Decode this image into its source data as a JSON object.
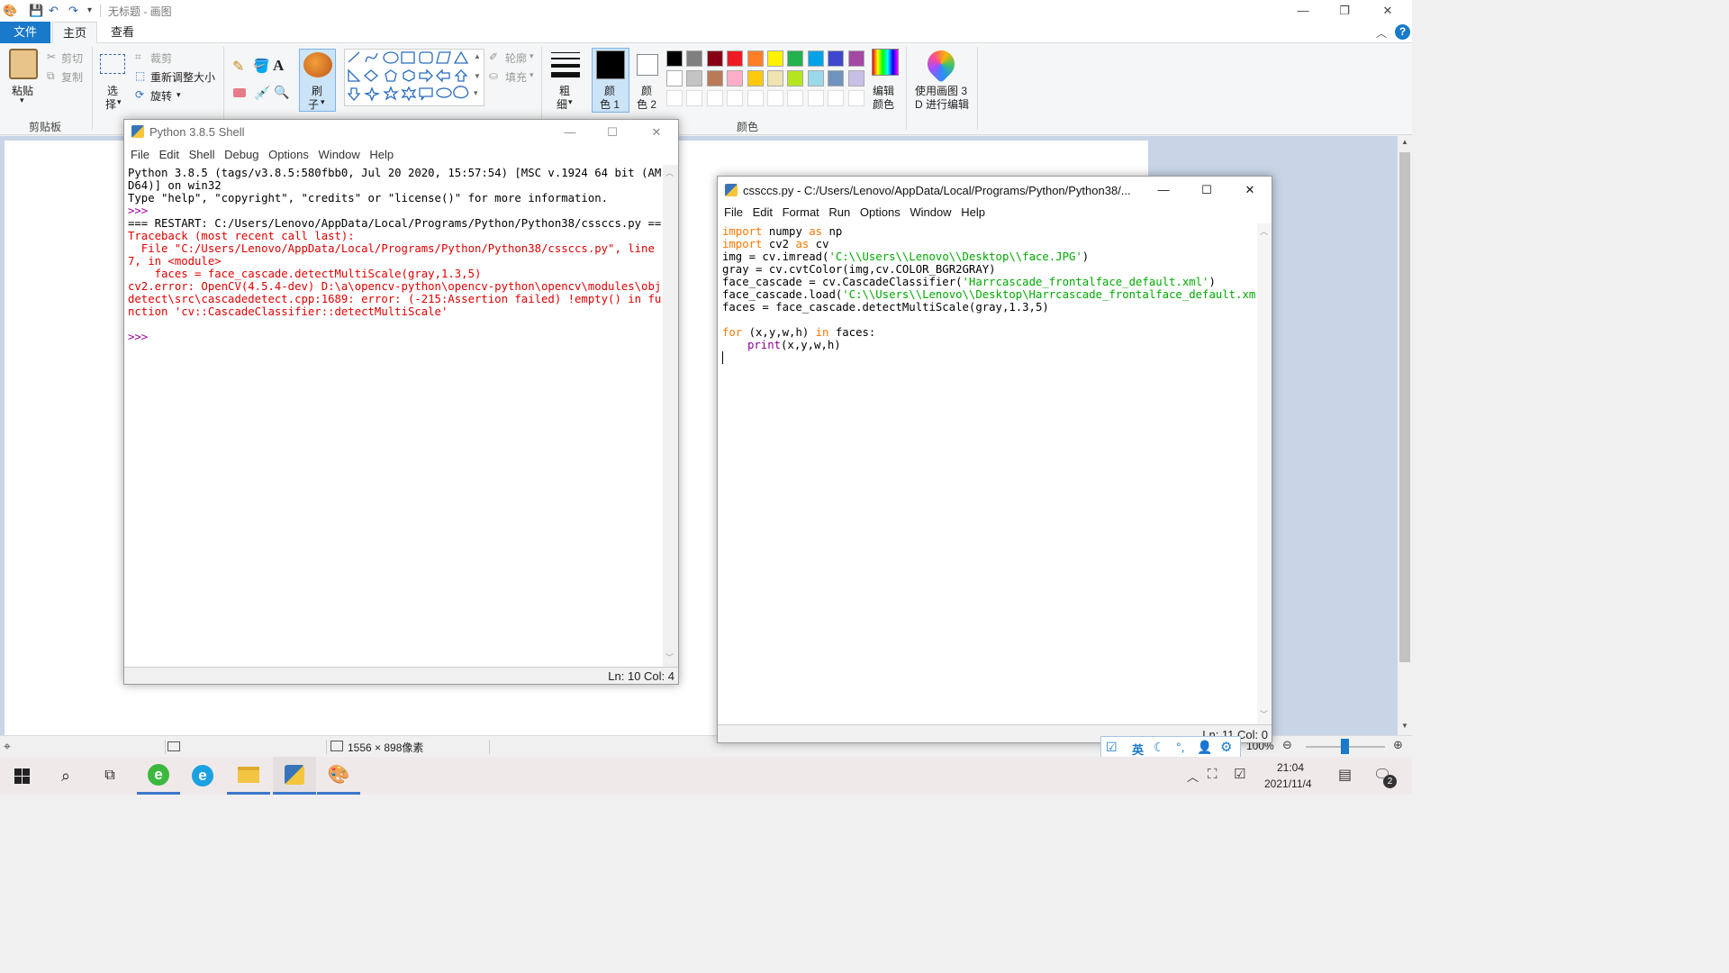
{
  "paint": {
    "title": "无标题 - 画图",
    "tabs": {
      "file": "文件",
      "home": "主页",
      "view": "查看"
    },
    "clipboard": {
      "paste": "粘贴",
      "cut": "剪切",
      "copy": "复制",
      "group": "剪贴板"
    },
    "image": {
      "select1": "选",
      "select2": "择",
      "crop": "裁剪",
      "resize": "重新调整大小",
      "rotate": "旋转"
    },
    "tools": {
      "brush1": "刷",
      "brush2": "子"
    },
    "shapes": {
      "outline": "轮廓",
      "fill": "填充"
    },
    "size": {
      "l1": "粗",
      "l2": "细"
    },
    "color1": {
      "l1": "颜",
      "l2": "色 1"
    },
    "color2": {
      "l1": "颜",
      "l2": "色 2"
    },
    "edit_colors": {
      "l1": "编辑",
      "l2": "颜色"
    },
    "paint3d": {
      "l1": "使用画图 3",
      "l2": "D 进行编辑"
    },
    "colors_group": "颜色",
    "palette_row1": [
      "#000000",
      "#7f7f7f",
      "#880015",
      "#ed1c24",
      "#ff7f27",
      "#fff200",
      "#22b14c",
      "#00a2e8",
      "#3f48cc",
      "#a349a4"
    ],
    "palette_row2": [
      "#ffffff",
      "#c3c3c3",
      "#b97a57",
      "#ffaec9",
      "#ffc90e",
      "#efe4b0",
      "#b5e61d",
      "#99d9ea",
      "#7092be",
      "#c8bfe7"
    ],
    "status": {
      "dimensions": "1556 × 898像素",
      "zoom": "100%"
    }
  },
  "shell": {
    "title": "Python 3.8.5 Shell",
    "menu": [
      "File",
      "Edit",
      "Shell",
      "Debug",
      "Options",
      "Window",
      "Help"
    ],
    "lines": {
      "l1": "Python 3.8.5 (tags/v3.8.5:580fbb0, Jul 20 2020, 15:57:54) [MSC v.1924 64 bit (AM",
      "l2": "D64)] on win32",
      "l3": "Type \"help\", \"copyright\", \"credits\" or \"license()\" for more information.",
      "l4": ">>> ",
      "l5": "=== RESTART: C:/Users/Lenovo/AppData/Local/Programs/Python/Python38/cssccs.py ==",
      "e1": "Traceback (most recent call last):",
      "e2": "  File \"C:/Users/Lenovo/AppData/Local/Programs/Python/Python38/cssccs.py\", line",
      "e3": "7, in <module>",
      "e4": "    faces = face_cascade.detectMultiScale(gray,1.3,5)",
      "e5": "cv2.error: OpenCV(4.5.4-dev) D:\\a\\opencv-python\\opencv-python\\opencv\\modules\\obj",
      "e6": "detect\\src\\cascadedetect.cpp:1689: error: (-215:Assertion failed) !empty() in fu",
      "e7": "nction 'cv::CascadeClassifier::detectMultiScale'",
      "prompt": ">>> "
    },
    "status": "Ln: 10  Col: 4"
  },
  "editor": {
    "title": "cssccs.py - C:/Users/Lenovo/AppData/Local/Programs/Python/Python38/...",
    "menu": [
      "File",
      "Edit",
      "Format",
      "Run",
      "Options",
      "Window",
      "Help"
    ],
    "c": {
      "import": "import",
      "as": "as",
      "for": "for",
      "in": "in",
      "l1b": " numpy ",
      "l1c": " np",
      "l2b": " cv2 ",
      "l2c": " cv",
      "l3a": "img = cv.imread(",
      "l3b": "'C:\\\\Users\\\\Lenovo\\\\Desktop\\\\face.JPG'",
      "l3c": ")",
      "l4": "gray = cv.cvtColor(img,cv.COLOR_BGR2GRAY)",
      "l5a": "face_cascade = cv.CascadeClassifier(",
      "l5b": "'Harrcascade_frontalface_default.xml'",
      "l5c": ")",
      "l6a": "face_cascade.load(",
      "l6b": "'C:\\\\Users\\\\Lenovo\\\\Desktop\\Harrcascade_frontalface_default.xm",
      "l7": "faces = face_cascade.detectMultiScale(gray,1.3,5)",
      "l9b": " (x,y,w,h) ",
      "l9c": " faces:",
      "print": "print",
      "l10b": "(x,y,w,h)"
    },
    "status": "Ln: 11  Col: 0"
  },
  "taskbar": {
    "time": "21:04",
    "date": "2021/11/4",
    "ime_lang": "英",
    "notif_count": "2"
  }
}
